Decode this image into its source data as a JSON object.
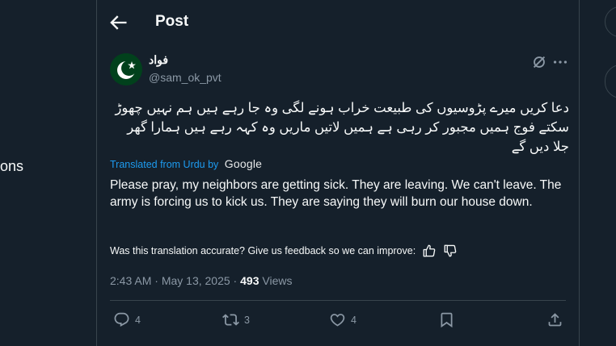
{
  "left_nav": {
    "partial_text": "ons"
  },
  "header": {
    "title": "Post"
  },
  "author": {
    "display_name": "فواد",
    "handle": "@sam_ok_pvt"
  },
  "post": {
    "urdu_text": "دعا کریں میرے پڑوسیوں کی طبیعت خراب ہونے لگی وہ جا رہے ہیں ہم نہیں چھوڑ سکتے فوج ہمیں مجبور کر رہی ہے ہمیں لاتیں ماریں وہ کہہ رہے ہیں ہمارا گھر جلا دیں گے",
    "translated_label": "Translated from Urdu by",
    "translator": "Google",
    "english_text": "Please pray, my neighbors are getting sick. They are leaving. We can't leave. The army is forcing us to kick us. They are saying they will burn our house down.",
    "feedback_prompt": "Was this translation accurate? Give us feedback so we can improve:"
  },
  "meta": {
    "time": "2:43 AM",
    "separator1": " · ",
    "date": "May 13, 2025",
    "separator2": " · ",
    "views_count": "493",
    "views_label": " Views"
  },
  "actions": {
    "replies": "4",
    "reposts": "3",
    "likes": "4"
  },
  "icons": {
    "back": "arrow-left-icon",
    "grok": "grok-icon",
    "more": "more-horizontal-icon",
    "reply": "reply-icon",
    "repost": "repost-icon",
    "like": "heart-icon",
    "bookmark": "bookmark-icon",
    "share": "share-icon",
    "thumbs_up": "thumbs-up-icon",
    "thumbs_down": "thumbs-down-icon"
  },
  "colors": {
    "background": "#15202b",
    "border": "#38444d",
    "text": "#f7f9f9",
    "muted": "#8b98a5",
    "accent": "#1d9bf0",
    "flag_green": "#01411c"
  }
}
